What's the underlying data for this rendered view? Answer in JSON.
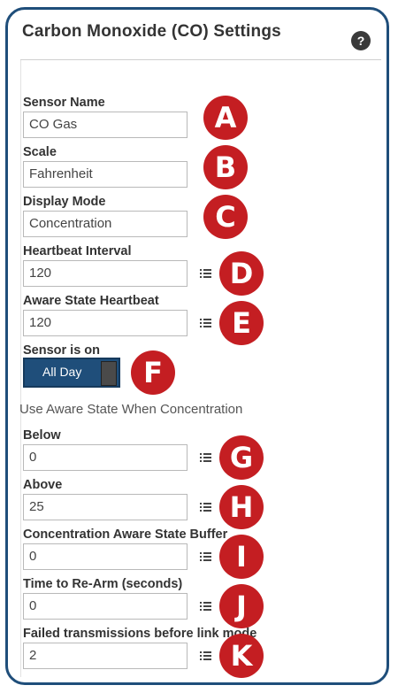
{
  "panel": {
    "title": "Carbon Monoxide (CO) Settings",
    "help_icon": "help-icon"
  },
  "fields": {
    "sensor_name": {
      "label": "Sensor Name",
      "value": "CO Gas",
      "badge": "A"
    },
    "scale": {
      "label": "Scale",
      "value": "Fahrenheit",
      "badge": "B"
    },
    "display_mode": {
      "label": "Display Mode",
      "value": "Concentration",
      "badge": "C"
    },
    "heartbeat_interval": {
      "label": "Heartbeat Interval",
      "value": "120",
      "badge": "D"
    },
    "aware_state_heartbeat": {
      "label": "Aware State Heartbeat",
      "value": "120",
      "badge": "E"
    },
    "sensor_on": {
      "label": "Sensor is on",
      "value": "All Day",
      "badge": "F"
    },
    "aware_note": "Use Aware State When Concentration",
    "below": {
      "label": "Below",
      "value": "0",
      "badge": "G"
    },
    "above": {
      "label": "Above",
      "value": "25",
      "badge": "H"
    },
    "concentration_buffer": {
      "label": "Concentration Aware State Buffer",
      "value": "0",
      "badge": "I"
    },
    "rearm": {
      "label": "Time to Re-Arm (seconds)",
      "value": "0",
      "badge": "J"
    },
    "failed_tx": {
      "label": "Failed transmissions before link mode",
      "value": "2",
      "badge": "K"
    }
  },
  "colors": {
    "accent": "#1f4e7a",
    "badge": "#c41e22"
  }
}
